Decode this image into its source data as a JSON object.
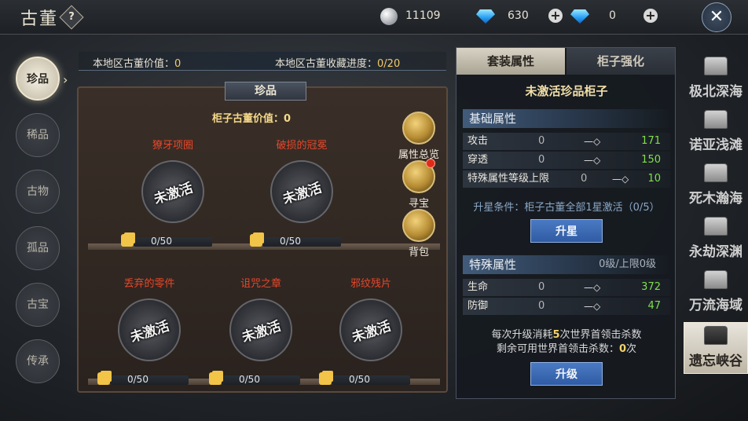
{
  "header": {
    "title": "古董",
    "help": "?",
    "coins": "11109",
    "gems": "630",
    "gems2": "0",
    "plus": "+",
    "close": "✕"
  },
  "nav": {
    "items": [
      "珍品",
      "稀品",
      "古物",
      "孤品",
      "古宝",
      "传承"
    ],
    "active": "珍品"
  },
  "info": {
    "value_label": "本地区古董价值：",
    "value": "0",
    "progress_label": "本地区古董收藏进度：",
    "progress": "0/20"
  },
  "cabinet": {
    "tab": "珍品",
    "value_label": "柜子古董价值：",
    "value": "0",
    "slots": [
      {
        "name": "獠牙项圈",
        "status": "未激活",
        "progress": "0/50"
      },
      {
        "name": "破损的冠冕",
        "status": "未激活",
        "progress": "0/50"
      },
      {
        "name": "丢弃的零件",
        "status": "未激活",
        "progress": "0/50"
      },
      {
        "name": "诅咒之章",
        "status": "未激活",
        "progress": "0/50"
      },
      {
        "name": "邪纹残片",
        "status": "未激活",
        "progress": "0/50"
      }
    ],
    "side_buttons": [
      "属性总览",
      "寻宝",
      "背包"
    ]
  },
  "panel": {
    "tabs": [
      "套装属性",
      "柜子强化"
    ],
    "cabinet_name": "未激活珍品柜子",
    "basic_title": "基础属性",
    "basic_rows": [
      {
        "name": "攻击",
        "cur": "0",
        "next": "171"
      },
      {
        "name": "穿透",
        "cur": "0",
        "next": "150"
      },
      {
        "name": "特殊属性等级上限",
        "cur": "0",
        "next": "10"
      }
    ],
    "upgrade_cond": "升星条件：柜子古董全部1星激活（0/5）",
    "star_button": "升星",
    "special_title": "特殊属性",
    "special_level": "0级/上限0级",
    "special_rows": [
      {
        "name": "生命",
        "cur": "0",
        "next": "372"
      },
      {
        "name": "防御",
        "cur": "0",
        "next": "47"
      }
    ],
    "note1_a": "每次升级消耗",
    "note1_b": "5",
    "note1_c": "次世界首领击杀数",
    "note2_a": "剩余可用世界首领击杀数：",
    "note2_b": "0",
    "note2_c": "次",
    "level_button": "升级"
  },
  "regions": {
    "items": [
      "极北深海",
      "诺亚浅滩",
      "死木瀚海",
      "永劫深渊",
      "万流海域",
      "遗忘峡谷"
    ],
    "active": "遗忘峡谷"
  }
}
